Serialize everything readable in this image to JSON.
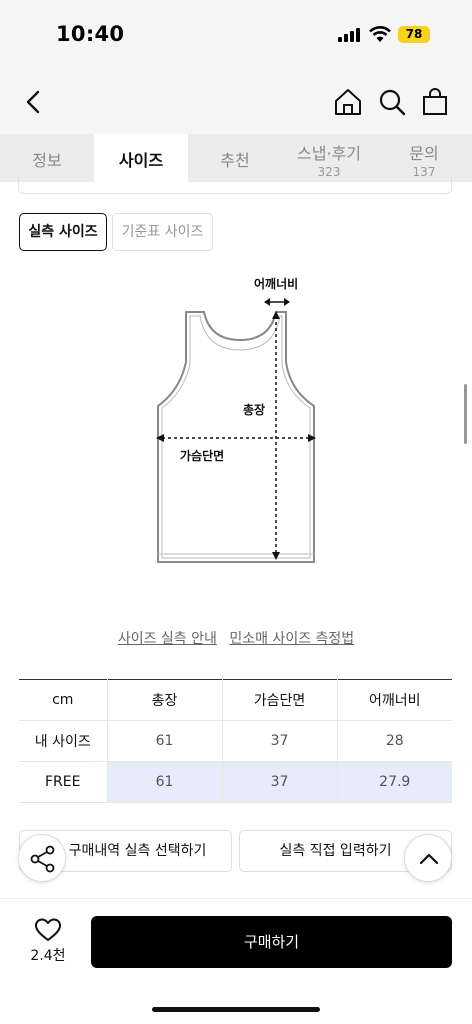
{
  "status": {
    "time": "10:40",
    "battery": "78"
  },
  "tabs": [
    {
      "label": "정보",
      "count": ""
    },
    {
      "label": "사이즈",
      "count": ""
    },
    {
      "label": "추천",
      "count": ""
    },
    {
      "label": "스냅·후기",
      "count": "323"
    },
    {
      "label": "문의",
      "count": "137"
    }
  ],
  "size_toggle": {
    "actual": "실측 사이즈",
    "standard": "기준표 사이즈"
  },
  "diagram": {
    "shoulder": "어깨너비",
    "length": "총장",
    "chest": "가슴단면"
  },
  "links": {
    "guide": "사이즈 실측 안내",
    "method": "민소매 사이즈 측정법"
  },
  "table": {
    "headers": [
      "cm",
      "총장",
      "가슴단면",
      "어깨너비"
    ],
    "rows": [
      [
        "내 사이즈",
        "61",
        "37",
        "28"
      ],
      [
        "FREE",
        "61",
        "37",
        "27.9"
      ]
    ]
  },
  "actions": {
    "purchase_history": "구매내역 실측 선택하기",
    "direct_input": "실측 직접 입력하기"
  },
  "bottom": {
    "likes": "2.4천",
    "buy": "구매하기"
  },
  "colors": {
    "selected_row": "#e7ecfb",
    "battery": "#f6d21b"
  }
}
